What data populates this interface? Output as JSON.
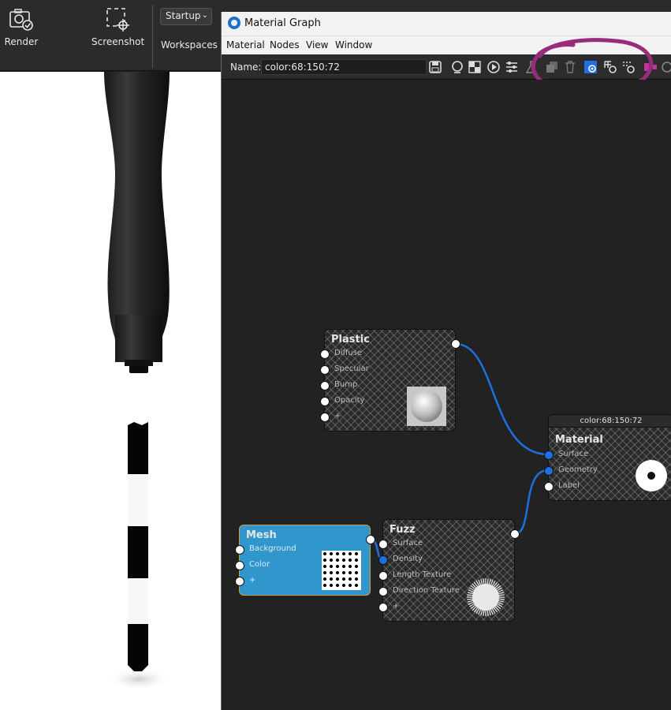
{
  "app_toolbar": {
    "render_label": "Render",
    "screenshot_label": "Screenshot",
    "startup_value": "Startup",
    "workspaces_label": "Workspaces"
  },
  "window": {
    "title": "Material Graph",
    "menu": [
      "Material",
      "Nodes",
      "View",
      "Window"
    ],
    "name_label": "Name:",
    "name_value": "color:68:150:72",
    "highlight_color": "#9a2a7a"
  },
  "nodes": {
    "plastic": {
      "title": "Plastic",
      "pins": [
        "Diffuse",
        "Specular",
        "Bump",
        "Opacity",
        "+"
      ]
    },
    "material": {
      "header": "color:68:150:72",
      "title": "Material",
      "pins": [
        "Surface",
        "Geometry",
        "Label"
      ]
    },
    "mesh": {
      "title": "Mesh",
      "pins": [
        "Background",
        "Color",
        "+"
      ]
    },
    "fuzz": {
      "title": "Fuzz",
      "pins": [
        "Surface",
        "Density",
        "Length Texture",
        "Direction Texture",
        "+"
      ]
    }
  },
  "colors": {
    "link": "#1e6fe0",
    "mesh_node": "#3096cc",
    "app_icon": "#1a73c9"
  }
}
